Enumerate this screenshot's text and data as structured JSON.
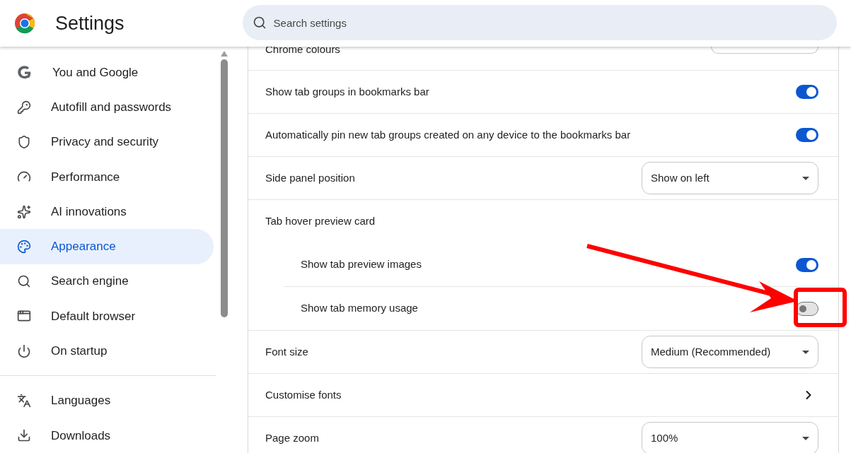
{
  "header": {
    "title": "Settings",
    "search": {
      "placeholder": "Search settings"
    }
  },
  "sidebar": {
    "items": [
      {
        "label": "You and Google",
        "selected": false
      },
      {
        "label": "Autofill and passwords",
        "selected": false
      },
      {
        "label": "Privacy and security",
        "selected": false
      },
      {
        "label": "Performance",
        "selected": false
      },
      {
        "label": "AI innovations",
        "selected": false
      },
      {
        "label": "Appearance",
        "selected": true
      },
      {
        "label": "Search engine",
        "selected": false
      },
      {
        "label": "Default browser",
        "selected": false
      },
      {
        "label": "On startup",
        "selected": false
      }
    ],
    "more_items": [
      {
        "label": "Languages",
        "selected": false
      },
      {
        "label": "Downloads",
        "selected": false
      }
    ]
  },
  "settings": [
    {
      "kind": "button",
      "label": "Chrome colours"
    },
    {
      "kind": "toggle",
      "label": "Show tab groups in bookmarks bar",
      "on": true
    },
    {
      "kind": "toggle",
      "label": "Automatically pin new tab groups created on any device to the bookmarks bar",
      "on": true
    },
    {
      "kind": "select",
      "label": "Side panel position",
      "value": "Show on left"
    },
    {
      "kind": "heading",
      "label": "Tab hover preview card",
      "children": [
        {
          "kind": "toggle",
          "label": "Show tab preview images",
          "on": true
        },
        {
          "kind": "toggle",
          "label": "Show tab memory usage",
          "on": false
        }
      ]
    },
    {
      "kind": "select",
      "label": "Font size",
      "value": "Medium (Recommended)"
    },
    {
      "kind": "link",
      "label": "Customise fonts"
    },
    {
      "kind": "select",
      "label": "Page zoom",
      "value": "100%"
    }
  ]
}
